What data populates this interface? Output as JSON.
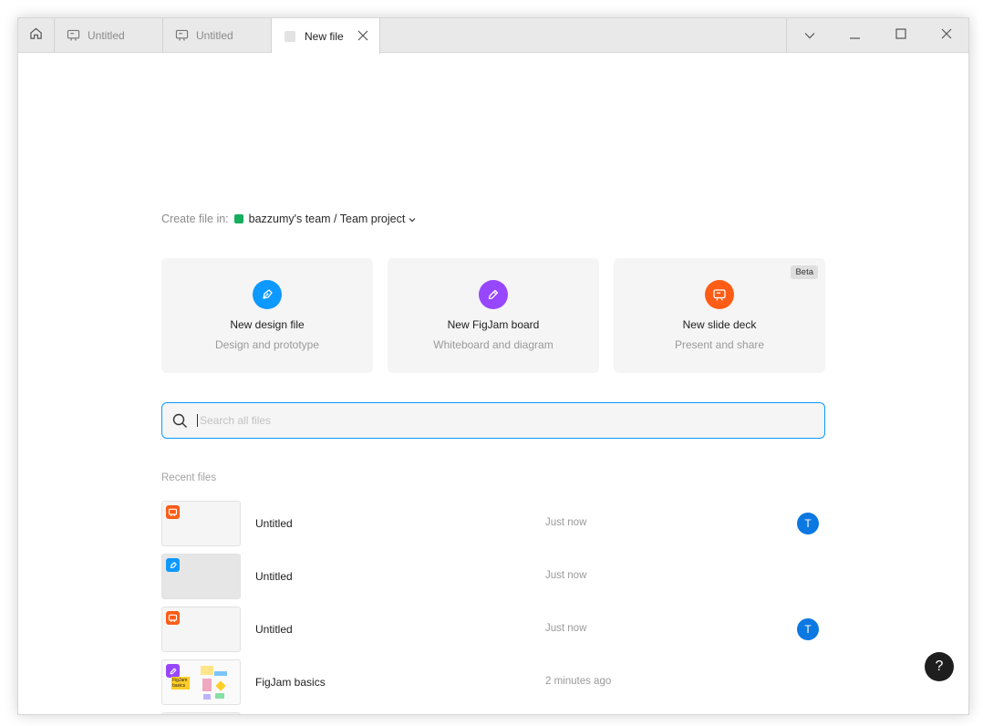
{
  "tabs": [
    {
      "label": "Untitled",
      "icon": "slide-icon"
    },
    {
      "label": "Untitled",
      "icon": "slide-icon"
    },
    {
      "label": "New file",
      "icon": "blank-file-icon"
    }
  ],
  "create_in": {
    "label": "Create file in:",
    "team": "bazzumy's team / Team project",
    "team_color": "#14ae5c"
  },
  "cards": [
    {
      "title": "New design file",
      "subtitle": "Design and prototype",
      "color": "#0d99ff",
      "icon": "pen-icon"
    },
    {
      "title": "New FigJam board",
      "subtitle": "Whiteboard and diagram",
      "color": "#9747ff",
      "icon": "marker-icon"
    },
    {
      "title": "New slide deck",
      "subtitle": "Present and share",
      "color": "#ff5c16",
      "icon": "slide-icon",
      "badge": "Beta"
    }
  ],
  "search": {
    "placeholder": "Search all files",
    "value": ""
  },
  "recent": {
    "label": "Recent files",
    "files": [
      {
        "name": "Untitled",
        "time": "Just now",
        "type": "slides",
        "avatar": "T"
      },
      {
        "name": "Untitled",
        "time": "Just now",
        "type": "design",
        "avatar": ""
      },
      {
        "name": "Untitled",
        "time": "Just now",
        "type": "slides",
        "avatar": "T"
      },
      {
        "name": "FigJam basics",
        "time": "2 minutes ago",
        "type": "figjam",
        "avatar": "",
        "thumb_text": "FigJam basics"
      }
    ]
  },
  "help": {
    "label": "?"
  }
}
